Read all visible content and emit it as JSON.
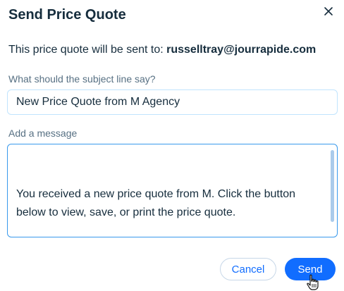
{
  "dialog": {
    "title": "Send Price Quote",
    "recipient_prefix": "This price quote will be sent to:",
    "recipient_email": "russelltray@jourrapide.com",
    "subject_label": "What should the subject line say?",
    "subject_value": "New Price Quote from M Agency",
    "message_label": "Add a message",
    "message_value": "You received a new price quote from M. Click the button below to view, save, or print the price quote.\n\nBest regards,\nM Agency",
    "cancel_label": "Cancel",
    "send_label": "Send"
  },
  "icons": {
    "close": "close-icon",
    "cursor": "hand-pointer-icon"
  },
  "colors": {
    "accent": "#116dff",
    "title_text": "#162d3d",
    "label_text": "#577083",
    "focus_border": "#3899ec"
  }
}
